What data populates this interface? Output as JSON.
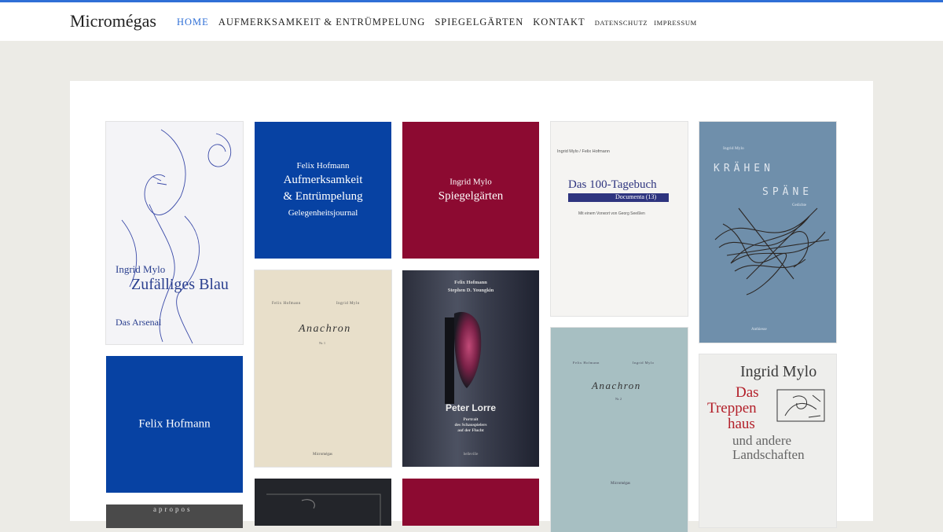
{
  "brand": "Micromégas",
  "nav": {
    "home": "HOME",
    "aufmerksamkeit": "AUFMERKSAMKEIT & ENTRÜMPELUNG",
    "spiegelgaerten": "SPIEGELGÄRTEN",
    "kontakt": "KONTAKT",
    "datenschutz": "DATENSCHUTZ",
    "impressum": "IMPRESSUM"
  },
  "colors": {
    "accent": "#2f6fd6",
    "blue_tile": "#0742a3",
    "red_tile": "#8c0a31"
  },
  "tiles": {
    "zufaelliges": {
      "author": "Ingrid Mylo",
      "title": "Zufälliges Blau",
      "publisher": "Das Arsenal"
    },
    "felix_aufmerk": {
      "author": "Felix Hofmann",
      "title1": "Aufmerksamkeit",
      "title2": "& Entrümpelung",
      "sub": "Gelegenheitsjournal"
    },
    "ingrid_spiegel": {
      "author": "Ingrid Mylo",
      "title": "Spiegelgärten"
    },
    "tagebuch": {
      "authors": "Ingrid Mylo / Felix Hofmann",
      "title": "Das 100-Tagebuch",
      "band": "Documenta (13)",
      "note": "Mit einem Vorwort von Georg Seeßlen"
    },
    "kraehen": {
      "author": "Ingrid Mylo",
      "title1": "KRÄHEN",
      "title2": "SPÄNE",
      "genre": "Gedichte",
      "publisher": "Anthiesse"
    },
    "felix_only": {
      "title": "Felix Hofmann"
    },
    "anachron1": {
      "left": "Felix Hofmann",
      "right": "Ingrid Mylo",
      "title": "Anachron",
      "nr": "Nr. 1",
      "publisher": "Micromégas"
    },
    "lorre": {
      "authors1": "Felix Hofmann",
      "authors2": "Stephen D. Youngkin",
      "title": "Peter Lorre",
      "sub1": "Portrait",
      "sub2": "des Schauspielers",
      "sub3": "auf der Flucht",
      "publisher": "belleville"
    },
    "anachron2": {
      "left": "Felix Hofmann",
      "right": "Ingrid Mylo",
      "title": "Anachron",
      "nr": "Nr. 2",
      "publisher": "Micromégas"
    },
    "treppenhaus": {
      "author": "Ingrid Mylo",
      "title1": "Das",
      "title2": "Treppen",
      "title3": "haus",
      "sub1": "und andere",
      "sub2": "Landschaften"
    },
    "apropos": {
      "title": "apropos"
    }
  }
}
